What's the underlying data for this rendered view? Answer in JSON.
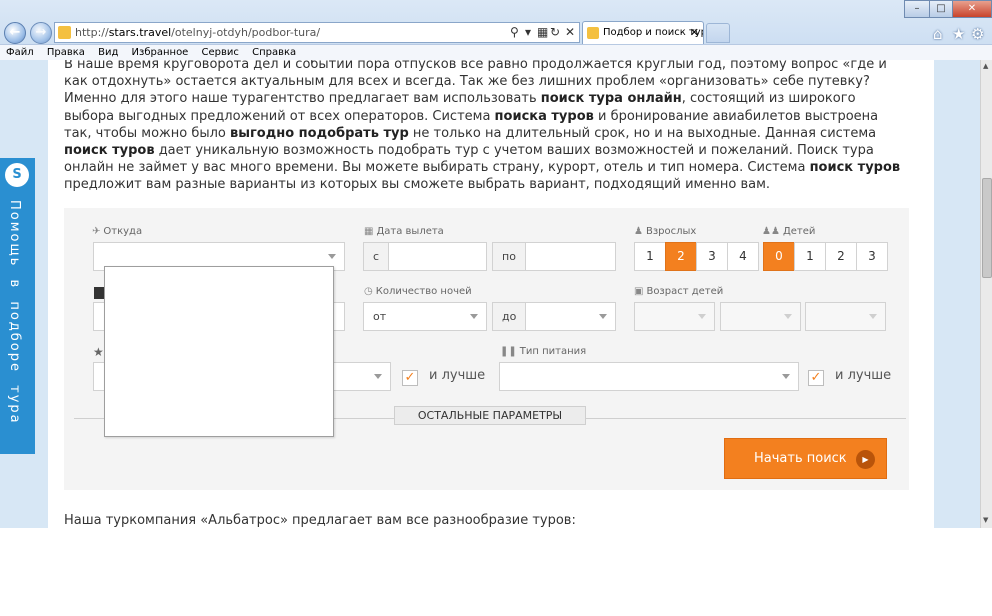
{
  "browser": {
    "address_url_prefix": "http://",
    "address_url_domain": "stars.travel",
    "address_url_path": "/otelnyj-otdyh/podbor-tura/",
    "tab_title": "Подбор и поиск тур...",
    "menu": [
      "Файл",
      "Правка",
      "Вид",
      "Избранное",
      "Сервис",
      "Справка"
    ]
  },
  "help_widget": {
    "label": "Помощь в подборе тура"
  },
  "intro_text": {
    "line1": "В наше время круговорота дел и событий пора отпусков все равно продолжается круглый год, поэтому вопрос «где и как отдохнуть» остается актуальным для всех и всегда. Так же без лишних проблем «организовать» себе путевку? Именно для этого наше турагентство предлагает вам использовать ",
    "b1": "поиск тура онлайн",
    "line2": ", состоящий из широкого выбора выгодных предложений от всех операторов. Система ",
    "b2": "поиска туров",
    "line3": " и бронирование авиабилетов выстроена так, чтобы можно было ",
    "b3": "выгодно подобрать тур",
    "line4": " не только на длительный срок, но и на выходные. Данная система ",
    "b4": "поиск туров",
    "line5": " дает уникальную возможность подобрать тур с учетом ваших возможностей и пожеланий. Поиск тура онлайн не займет у вас много времени. Вы можете выбирать страну, курорт, отель и тип номера. Система ",
    "b5": "поиск туров",
    "line6": " предложит вам разные варианты из которых вы сможете выбрать вариант, подходящий именно вам."
  },
  "search_form": {
    "from_label": "Откуда",
    "date_label": "Дата вылета",
    "date_from_prefix": "с",
    "date_to_prefix": "по",
    "adults_label": "Взрослых",
    "adults_options": [
      "1",
      "2",
      "3",
      "4"
    ],
    "adults_selected": "2",
    "children_label": "Детей",
    "children_options": [
      "0",
      "1",
      "2",
      "3"
    ],
    "children_selected": "0",
    "nights_label": "Количество ночей",
    "nights_from_prefix": "от",
    "nights_to_prefix": "до",
    "children_age_label": "Возраст детей",
    "meal_label": "Тип питания",
    "or_better_label": "и лучше",
    "more_params_label": "ОСТАЛЬНЫЕ ПАРАМЕТРЫ",
    "search_button_label": "Начать поиск"
  },
  "outro_text": "Наша туркомпания «Альбатрос» предлагает вам все разнообразие туров:",
  "colors": {
    "accent_orange": "#f3801f",
    "help_blue": "#2a8fd1",
    "page_bg": "#d7e7f5"
  }
}
